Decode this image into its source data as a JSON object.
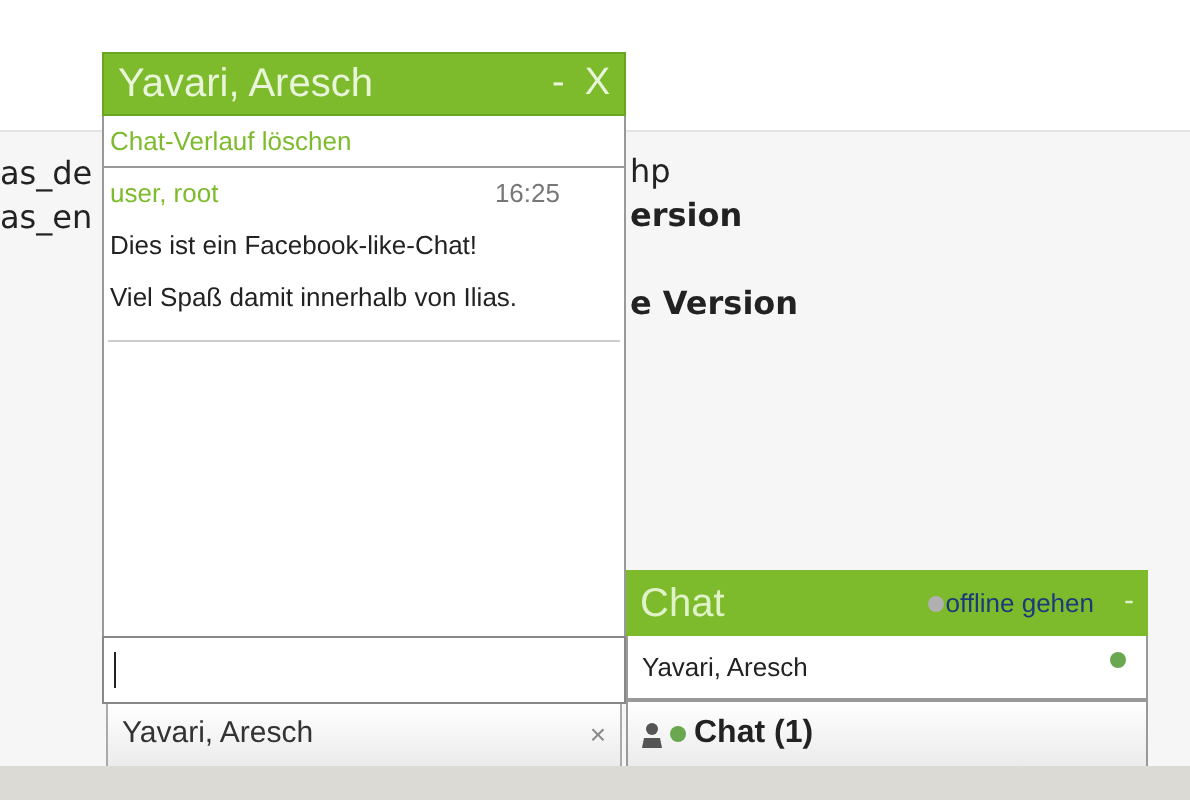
{
  "background": {
    "left_texts": [
      "as_de",
      "as_en"
    ],
    "right_texts": [
      {
        "text": "hp",
        "bold": false
      },
      {
        "text": "ersion",
        "bold": true
      },
      {
        "text": "e Version",
        "bold": true
      }
    ]
  },
  "chat_window": {
    "title": "Yavari, Aresch",
    "minimize": "-",
    "close": "X",
    "clear_history": "Chat-Verlauf löschen",
    "messages": [
      {
        "author": "user, root",
        "time": "16:25",
        "lines": [
          "Dies ist ein Facebook-like-Chat!",
          "Viel Spaß damit innerhalb von Ilias."
        ]
      }
    ],
    "tab": {
      "label": "Yavari, Aresch",
      "close": "×"
    }
  },
  "chat_panel": {
    "title": "Chat",
    "status_link": "offline gehen",
    "minimize": "-",
    "contacts": [
      {
        "name": "Yavari, Aresch",
        "online": true
      }
    ],
    "bar": {
      "label": "Chat (1)",
      "online": true
    }
  }
}
